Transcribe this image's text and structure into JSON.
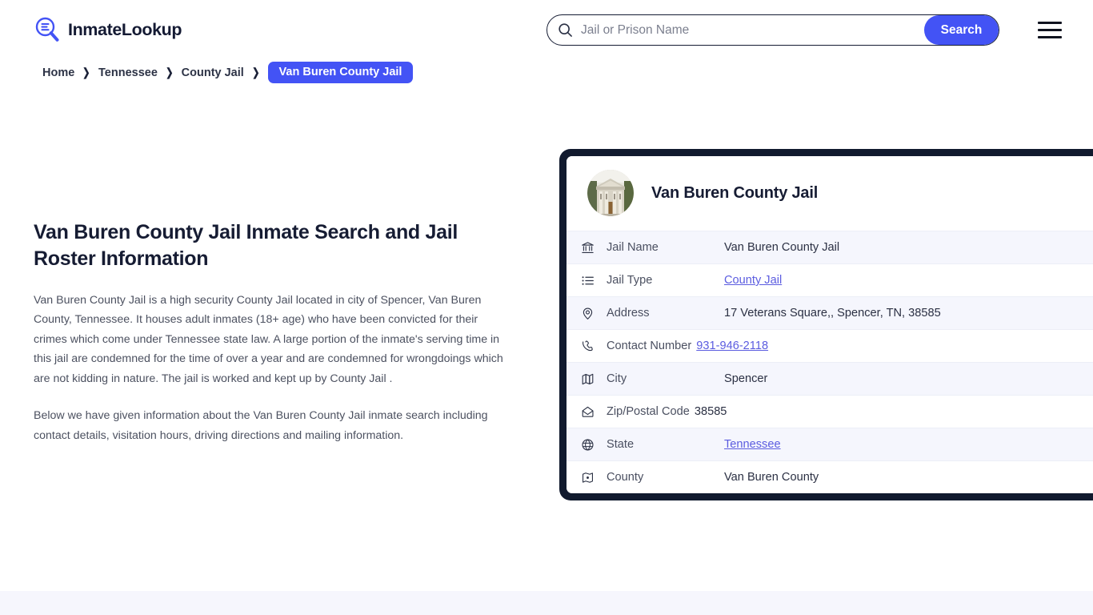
{
  "header": {
    "brand_name": "InmateLookup",
    "brand_icon": "magnifier-list-logo-icon",
    "search": {
      "placeholder": "Jail or Prison Name",
      "value": "",
      "icon": "search-icon",
      "button_label": "Search"
    },
    "menu_icon": "hamburger-menu-icon"
  },
  "breadcrumb": {
    "separator": "❯",
    "items": [
      {
        "label": "Home",
        "current": false
      },
      {
        "label": "Tennessee",
        "current": false
      },
      {
        "label": "County Jail",
        "current": false
      },
      {
        "label": "Van Buren County Jail",
        "current": true
      }
    ]
  },
  "main": {
    "page_title": "Van Buren County Jail Inmate Search and Jail Roster Information",
    "paragraph_1": "Van Buren County Jail is a high security County Jail located in city of Spencer, Van Buren County, Tennessee. It houses adult inmates (18+ age) who have been convicted for their crimes which come under Tennessee state law. A large portion of the inmate's serving time in this jail are condemned for the time of over a year and are condemned for wrongdoings which are not kidding in nature. The jail is worked and kept up by County Jail .",
    "paragraph_2": "Below we have given information about the Van Buren County Jail inmate search including contact details, visitation hours, driving directions and mailing information."
  },
  "info_card": {
    "avatar_icon": "courthouse-photo-avatar",
    "title": "Van Buren County Jail",
    "rows": [
      {
        "icon": "bank-icon",
        "label": "Jail Name",
        "value": "Van Buren County Jail",
        "link": false
      },
      {
        "icon": "list-icon",
        "label": "Jail Type",
        "value": "County Jail",
        "link": true
      },
      {
        "icon": "map-pin-icon",
        "label": "Address",
        "value": "17 Veterans Square,, Spencer, TN, 38585",
        "link": false
      },
      {
        "icon": "phone-icon",
        "label": "Contact Number",
        "value": "931-946-2118",
        "link": true
      },
      {
        "icon": "map-icon",
        "label": "City",
        "value": "Spencer",
        "link": false
      },
      {
        "icon": "envelope-icon",
        "label": "Zip/Postal Code",
        "value": "38585",
        "link": false
      },
      {
        "icon": "globe-icon",
        "label": "State",
        "value": "Tennessee",
        "link": true
      },
      {
        "icon": "county-map-icon",
        "label": "County",
        "value": "Van Buren County",
        "link": false
      }
    ]
  },
  "colors": {
    "accent": "#4353f5",
    "card_border": "#111a2e",
    "link": "#5b5ce0",
    "row_alt": "#f5f6fd",
    "band": "#f6f6fd"
  }
}
